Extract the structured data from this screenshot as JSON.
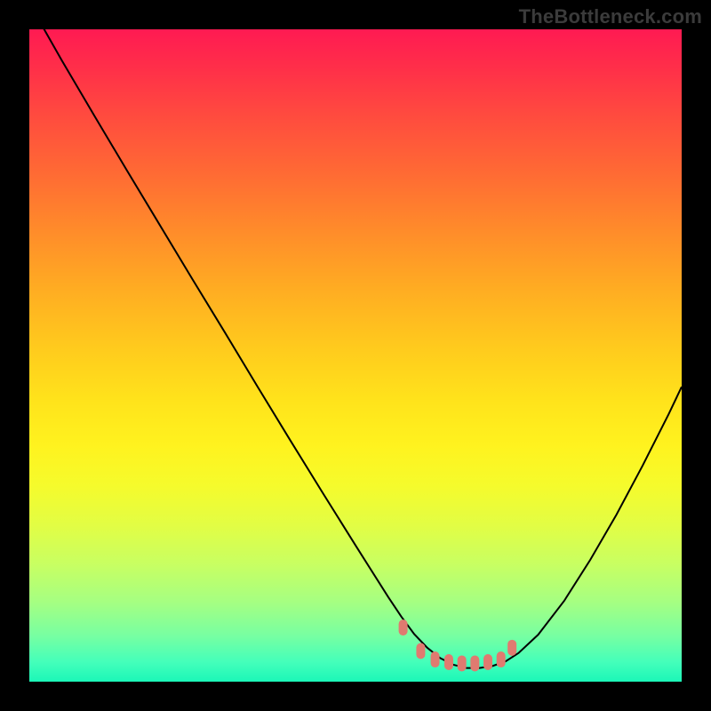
{
  "watermark": "TheBottleneck.com",
  "colors": {
    "curve_stroke": "#000000",
    "marker_fill": "#e07a70",
    "marker_stroke": "#d26a60"
  },
  "chart_data": {
    "type": "line",
    "title": "",
    "xlabel": "",
    "ylabel": "",
    "xlim": [
      0,
      100
    ],
    "ylim": [
      0,
      100
    ],
    "grid": false,
    "legend": false,
    "series": [
      {
        "name": "curve",
        "x": [
          0,
          5,
          10,
          15,
          20,
          25,
          30,
          35,
          40,
          45,
          50,
          55,
          57,
          59,
          61,
          63,
          65,
          67,
          69,
          71,
          73,
          75,
          78,
          82,
          86,
          90,
          94,
          98,
          100
        ],
        "y": [
          104,
          95.2,
          86.7,
          78.3,
          70.0,
          61.7,
          53.5,
          45.2,
          37.0,
          28.9,
          20.9,
          13.0,
          10.0,
          7.3,
          5.2,
          3.6,
          2.6,
          2.1,
          2.1,
          2.4,
          3.1,
          4.4,
          7.2,
          12.4,
          18.7,
          25.6,
          33.1,
          41.0,
          45.2
        ]
      }
    ],
    "markers": {
      "name": "highlight",
      "x": [
        57.3,
        60.0,
        62.2,
        64.3,
        66.3,
        68.3,
        70.3,
        72.3,
        74.0
      ],
      "y": [
        8.3,
        4.7,
        3.4,
        3.0,
        2.8,
        2.8,
        3.0,
        3.4,
        5.2
      ]
    }
  }
}
